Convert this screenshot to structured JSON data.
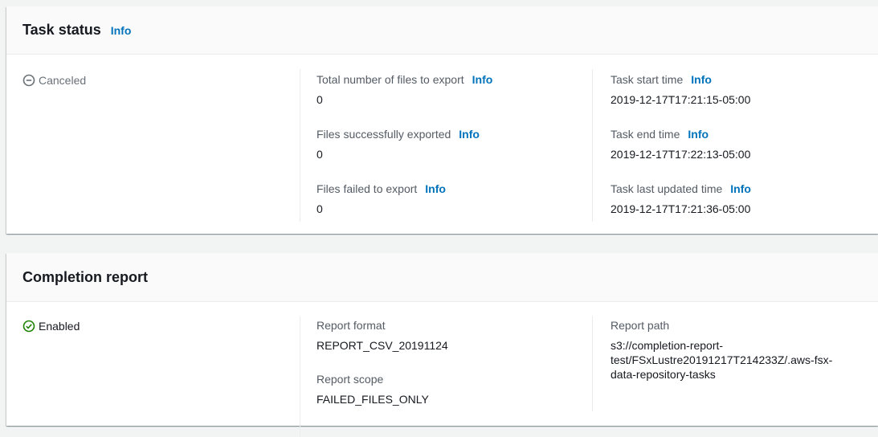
{
  "task_status": {
    "title": "Task status",
    "info": "Info",
    "status": "Canceled",
    "fields": {
      "total_files_label": "Total number of files to export",
      "total_files_value": "0",
      "success_label": "Files successfully exported",
      "success_value": "0",
      "failed_label": "Files failed to export",
      "failed_value": "0",
      "start_label": "Task start time",
      "start_value": "2019-12-17T17:21:15-05:00",
      "end_label": "Task end time",
      "end_value": "2019-12-17T17:22:13-05:00",
      "updated_label": "Task last updated time",
      "updated_value": "2019-12-17T17:21:36-05:00"
    }
  },
  "completion_report": {
    "title": "Completion report",
    "status": "Enabled",
    "fields": {
      "format_label": "Report format",
      "format_value": "REPORT_CSV_20191124",
      "scope_label": "Report scope",
      "scope_value": "FAILED_FILES_ONLY",
      "path_label": "Report path",
      "path_line1": "s3://completion-report-",
      "path_line2": "test/FSxLustre20191217T214233Z/.aws-fsx-",
      "path_line3": "data-repository-tasks"
    }
  },
  "colors": {
    "link": "#0073bb",
    "success": "#1d8102",
    "muted": "#687078",
    "label": "#545b64"
  }
}
